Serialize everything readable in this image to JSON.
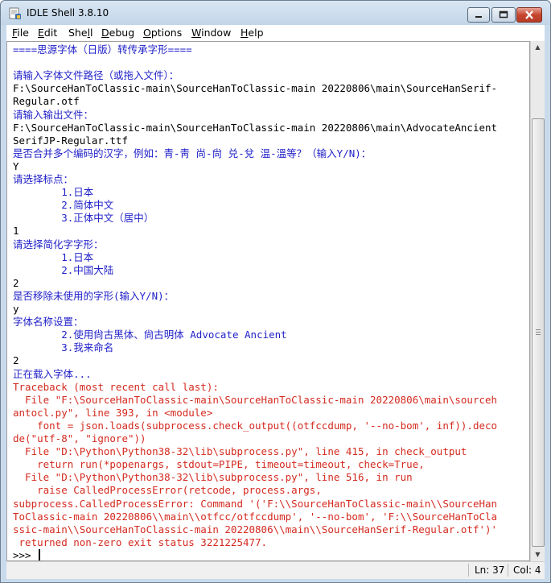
{
  "window": {
    "title": "IDLE Shell 3.8.10",
    "icon": "idle-python-icon",
    "controls": {
      "minimize": "minimize-icon",
      "maximize": "maximize-icon",
      "close": "close-icon"
    }
  },
  "menu": [
    {
      "label": "File",
      "accel": "F",
      "rest": "ile"
    },
    {
      "label": "Edit",
      "accel": "E",
      "rest": "dit"
    },
    {
      "label": "Shell",
      "pre": "She",
      "accel": "l",
      "rest": "l"
    },
    {
      "label": "Debug",
      "accel": "D",
      "rest": "ebug"
    },
    {
      "label": "Options",
      "accel": "O",
      "rest": "ptions"
    },
    {
      "label": "Window",
      "accel": "W",
      "rest": "indow"
    },
    {
      "label": "Help",
      "accel": "H",
      "rest": "elp"
    }
  ],
  "shell_lines": [
    {
      "text": "====思源字体（日版）转传承字形====",
      "style": "blue"
    },
    {
      "text": "",
      "style": "plain"
    },
    {
      "text": "请输入字体文件路径（或拖入文件）：",
      "style": "blue"
    },
    {
      "text": "F:\\SourceHanToClassic-main\\SourceHanToClassic-main 20220806\\main\\SourceHanSerif-",
      "style": "plain"
    },
    {
      "text": "Regular.otf",
      "style": "plain"
    },
    {
      "text": "请输入输出文件：",
      "style": "blue"
    },
    {
      "text": "F:\\SourceHanToClassic-main\\SourceHanToClassic-main 20220806\\main\\AdvocateAncient",
      "style": "plain"
    },
    {
      "text": "SerifJP-Regular.ttf",
      "style": "plain"
    },
    {
      "text": "是否合并多个编码的汉字，例如：青-靑 尚-尙 兑-兌 温-溫等？（输入Y/N)：",
      "style": "blue"
    },
    {
      "text": "Y",
      "style": "plain"
    },
    {
      "text": "请选择标点：",
      "style": "blue"
    },
    {
      "text": "        1.日本",
      "style": "blue"
    },
    {
      "text": "        2.简体中文",
      "style": "blue"
    },
    {
      "text": "        3.正体中文（居中）",
      "style": "blue"
    },
    {
      "text": "1",
      "style": "plain"
    },
    {
      "text": "请选择简化字字形：",
      "style": "blue"
    },
    {
      "text": "        1.日本",
      "style": "blue"
    },
    {
      "text": "        2.中国大陆",
      "style": "blue"
    },
    {
      "text": "2",
      "style": "plain"
    },
    {
      "text": "是否移除未使用的字形(输入Y/N)：",
      "style": "blue"
    },
    {
      "text": "y",
      "style": "plain"
    },
    {
      "text": "字体名称设置：",
      "style": "blue"
    },
    {
      "text": "        2.使用尙古黑体、尙古明体 Advocate Ancient",
      "style": "blue"
    },
    {
      "text": "        3.我来命名",
      "style": "blue"
    },
    {
      "text": "2",
      "style": "plain"
    },
    {
      "text": "正在载入字体...",
      "style": "blue"
    },
    {
      "text": "Traceback (most recent call last):",
      "style": "red"
    },
    {
      "text": "  File \"F:\\SourceHanToClassic-main\\SourceHanToClassic-main 20220806\\main\\sourceh",
      "style": "red"
    },
    {
      "text": "antocl.py\", line 393, in <module>",
      "style": "red"
    },
    {
      "text": "    font = json.loads(subprocess.check_output((otfccdump, '--no-bom', inf)).deco",
      "style": "red"
    },
    {
      "text": "de(\"utf-8\", \"ignore\"))",
      "style": "red"
    },
    {
      "text": "  File \"D:\\Python\\Python38-32\\lib\\subprocess.py\", line 415, in check_output",
      "style": "red"
    },
    {
      "text": "    return run(*popenargs, stdout=PIPE, timeout=timeout, check=True,",
      "style": "red"
    },
    {
      "text": "  File \"D:\\Python\\Python38-32\\lib\\subprocess.py\", line 516, in run",
      "style": "red"
    },
    {
      "text": "    raise CalledProcessError(retcode, process.args,",
      "style": "red"
    },
    {
      "text": "subprocess.CalledProcessError: Command '('F:\\\\SourceHanToClassic-main\\\\SourceHan",
      "style": "red"
    },
    {
      "text": "ToClassic-main 20220806\\\\main\\\\otfcc/otfccdump', '--no-bom', 'F:\\\\SourceHanToCla",
      "style": "red"
    },
    {
      "text": "ssic-main\\\\SourceHanToClassic-main 20220806\\\\main\\\\SourceHanSerif-Regular.otf')'",
      "style": "red"
    },
    {
      "text": " returned non-zero exit status 3221225477.",
      "style": "red"
    }
  ],
  "prompt": ">>> ",
  "status": {
    "line": "Ln: 37",
    "col": "Col: 4"
  },
  "colors": {
    "prompt_output": "#1f1fc8",
    "error": "#d42a1f",
    "input": "#000000"
  }
}
